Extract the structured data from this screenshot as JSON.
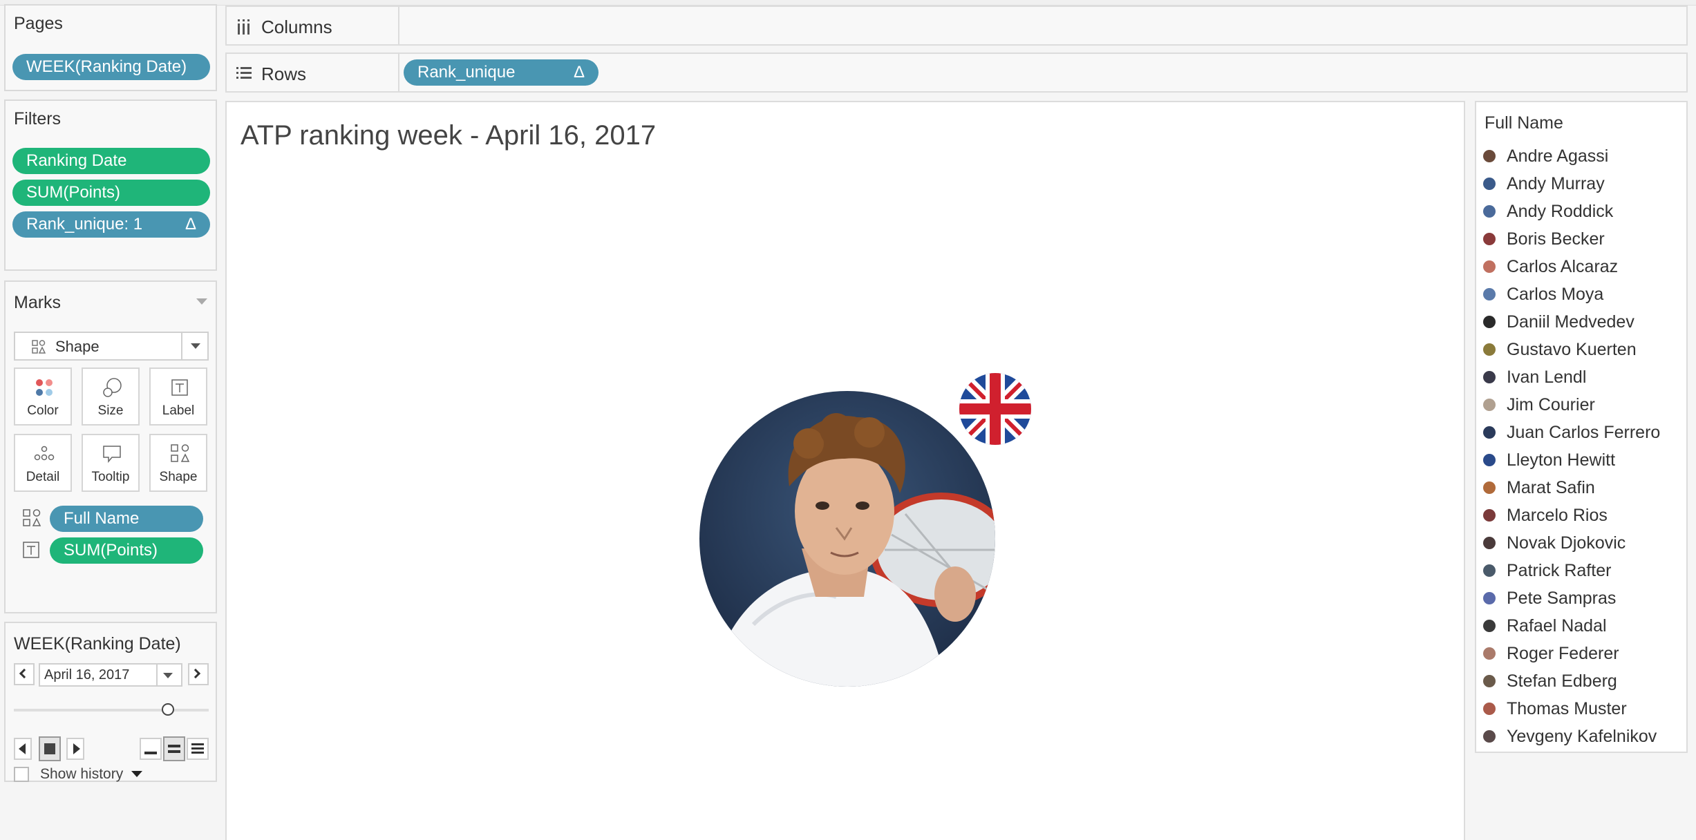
{
  "pages": {
    "title": "Pages",
    "pill": "WEEK(Ranking Date)"
  },
  "filters": {
    "title": "Filters",
    "items": [
      "Ranking Date",
      "SUM(Points)",
      "Rank_unique: 1"
    ]
  },
  "marks": {
    "title": "Marks",
    "type": "Shape",
    "buttons": [
      "Color",
      "Size",
      "Label",
      "Detail",
      "Tooltip",
      "Shape"
    ],
    "fields": [
      "Full Name",
      "SUM(Points)"
    ]
  },
  "page_control": {
    "title": "WEEK(Ranking Date)",
    "date": "April 16, 2017",
    "show_history": "Show history"
  },
  "columns_shelf": {
    "label": "Columns"
  },
  "rows_shelf": {
    "label": "Rows",
    "pill": "Rank_unique",
    "delta": "Δ"
  },
  "view": {
    "title": "ATP ranking week - April 16, 2017"
  },
  "legend": {
    "title": "Full Name",
    "names": [
      "Andre Agassi",
      "Andy Murray",
      "Andy Roddick",
      "Boris Becker",
      "Carlos Alcaraz",
      "Carlos Moya",
      "Daniil Medvedev",
      "Gustavo Kuerten",
      "Ivan Lendl",
      "Jim Courier",
      "Juan Carlos Ferrero",
      "Lleyton Hewitt",
      "Marat Safin",
      "Marcelo Rios",
      "Novak Djokovic",
      "Patrick Rafter",
      "Pete Sampras",
      "Rafael Nadal",
      "Roger Federer",
      "Stefan Edberg",
      "Thomas Muster",
      "Yevgeny Kafelnikov"
    ],
    "colors": [
      "#6a4a3a",
      "#3a5a8a",
      "#4a6a9a",
      "#8a3a3a",
      "#c07060",
      "#5a7aaa",
      "#2a2a2a",
      "#8a7a3a",
      "#3a3a4a",
      "#b0a090",
      "#2a3a5a",
      "#2a4a8a",
      "#b06a3a",
      "#7a3a3a",
      "#4a3a3a",
      "#4a5a6a",
      "#5a6aaa",
      "#3a3a3a",
      "#aa7a6a",
      "#6a5a4a",
      "#aa5a4a",
      "#5a4a4a"
    ]
  },
  "colors": {
    "pill_blue": "#4996b2",
    "pill_green": "#1fb579"
  }
}
